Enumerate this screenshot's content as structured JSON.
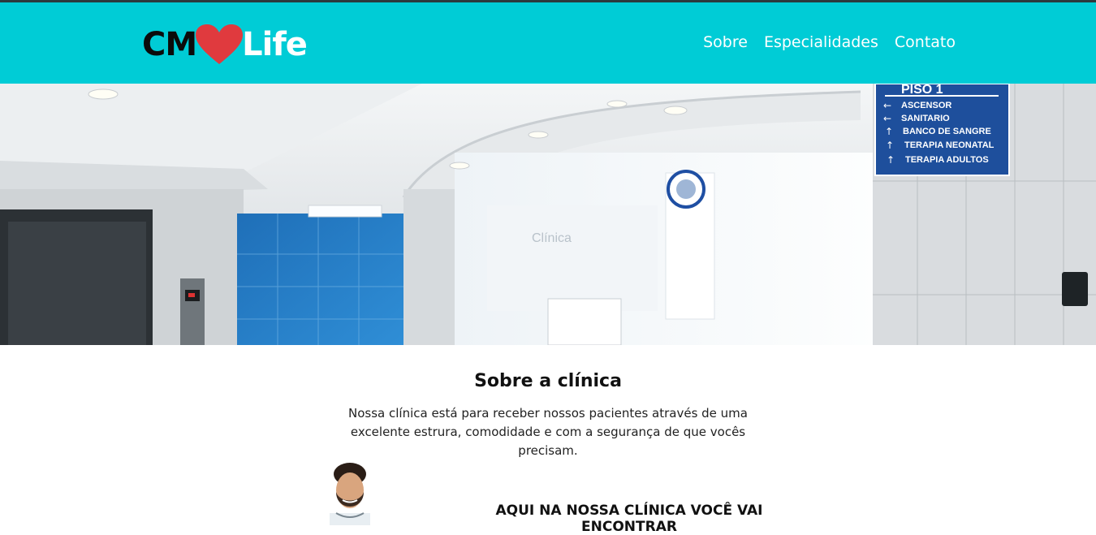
{
  "brand": {
    "logo_left": "CM",
    "logo_right": "Life",
    "heart_color": "#e03a3e",
    "header_color": "#00ccd6"
  },
  "nav": {
    "items": [
      {
        "label": "Sobre"
      },
      {
        "label": "Especialidades"
      },
      {
        "label": "Contato"
      }
    ]
  },
  "hero": {
    "sign": {
      "title": "PISO 1",
      "items": [
        "ASCENSOR",
        "SANITARIO",
        "BANCO DE SANGRE",
        "TERAPIA NEONATAL",
        "TERAPIA ADULTOS"
      ]
    },
    "glass_text": "Clínica"
  },
  "about": {
    "title": "Sobre a clínica",
    "text": "Nossa clínica está para receber nossos pacientes através de uma excelente estrura, comodidade e com a segurança de que vocês precisam.",
    "subtitle": "AQUI NA NOSSA CLÍNICA VOCÊ VAI ENCONTRAR"
  }
}
